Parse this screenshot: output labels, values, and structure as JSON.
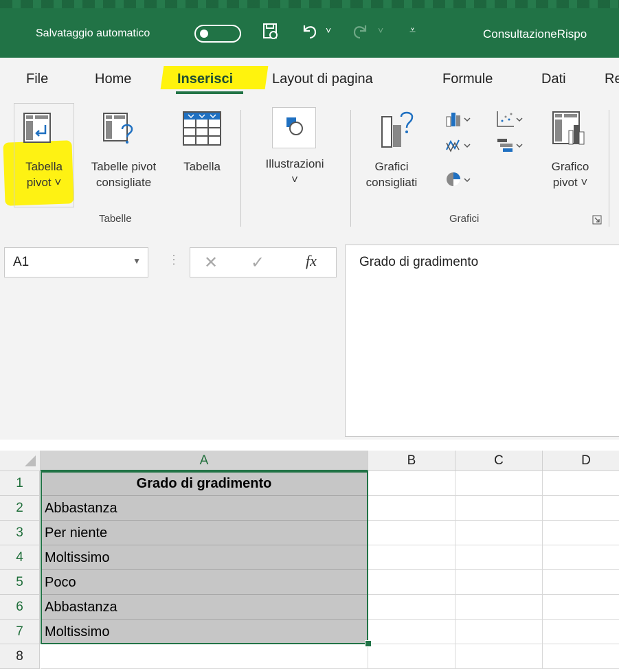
{
  "title_bar": {
    "autosave_label": "Salvataggio automatico",
    "filename": "ConsultazioneRispo"
  },
  "tabs": [
    "File",
    "Home",
    "Inserisci",
    "Layout di pagina",
    "Formule",
    "Dati",
    "Re"
  ],
  "active_tab": "Inserisci",
  "ribbon": {
    "tabella_pivot": {
      "line1": "Tabella",
      "line2": "pivot ˅"
    },
    "tabelle_pivot_consigliate": {
      "line1": "Tabelle pivot",
      "line2": "consigliate"
    },
    "tabella": "Tabella",
    "illustrazioni": {
      "line1": "Illustrazioni",
      "line2": "˅"
    },
    "grafici_consigliati": {
      "line1": "Grafici",
      "line2": "consigliati"
    },
    "grafico_pivot": {
      "line1": "Grafico",
      "line2": "pivot ˅"
    },
    "group_tabelle": "Tabelle",
    "group_grafici": "Grafici"
  },
  "formula_bar": {
    "name_box": "A1",
    "fx_symbol": "fx",
    "cancel_symbol": "✕",
    "enter_symbol": "✓",
    "content": "Grado di gradimento"
  },
  "grid": {
    "columns": [
      "A",
      "B",
      "C",
      "D"
    ],
    "rows": [
      {
        "num": "1",
        "value": "Grado di gradimento",
        "header": true
      },
      {
        "num": "2",
        "value": "Abbastanza"
      },
      {
        "num": "3",
        "value": "Per niente"
      },
      {
        "num": "4",
        "value": "Moltissimo"
      },
      {
        "num": "5",
        "value": "Poco"
      },
      {
        "num": "6",
        "value": "Abbastanza"
      },
      {
        "num": "7",
        "value": "Moltissimo"
      },
      {
        "num": "8",
        "value": ""
      }
    ]
  },
  "colors": {
    "excel_green": "#217346",
    "highlight_yellow": "#fff200",
    "selection_fill": "#c6c6c6"
  }
}
